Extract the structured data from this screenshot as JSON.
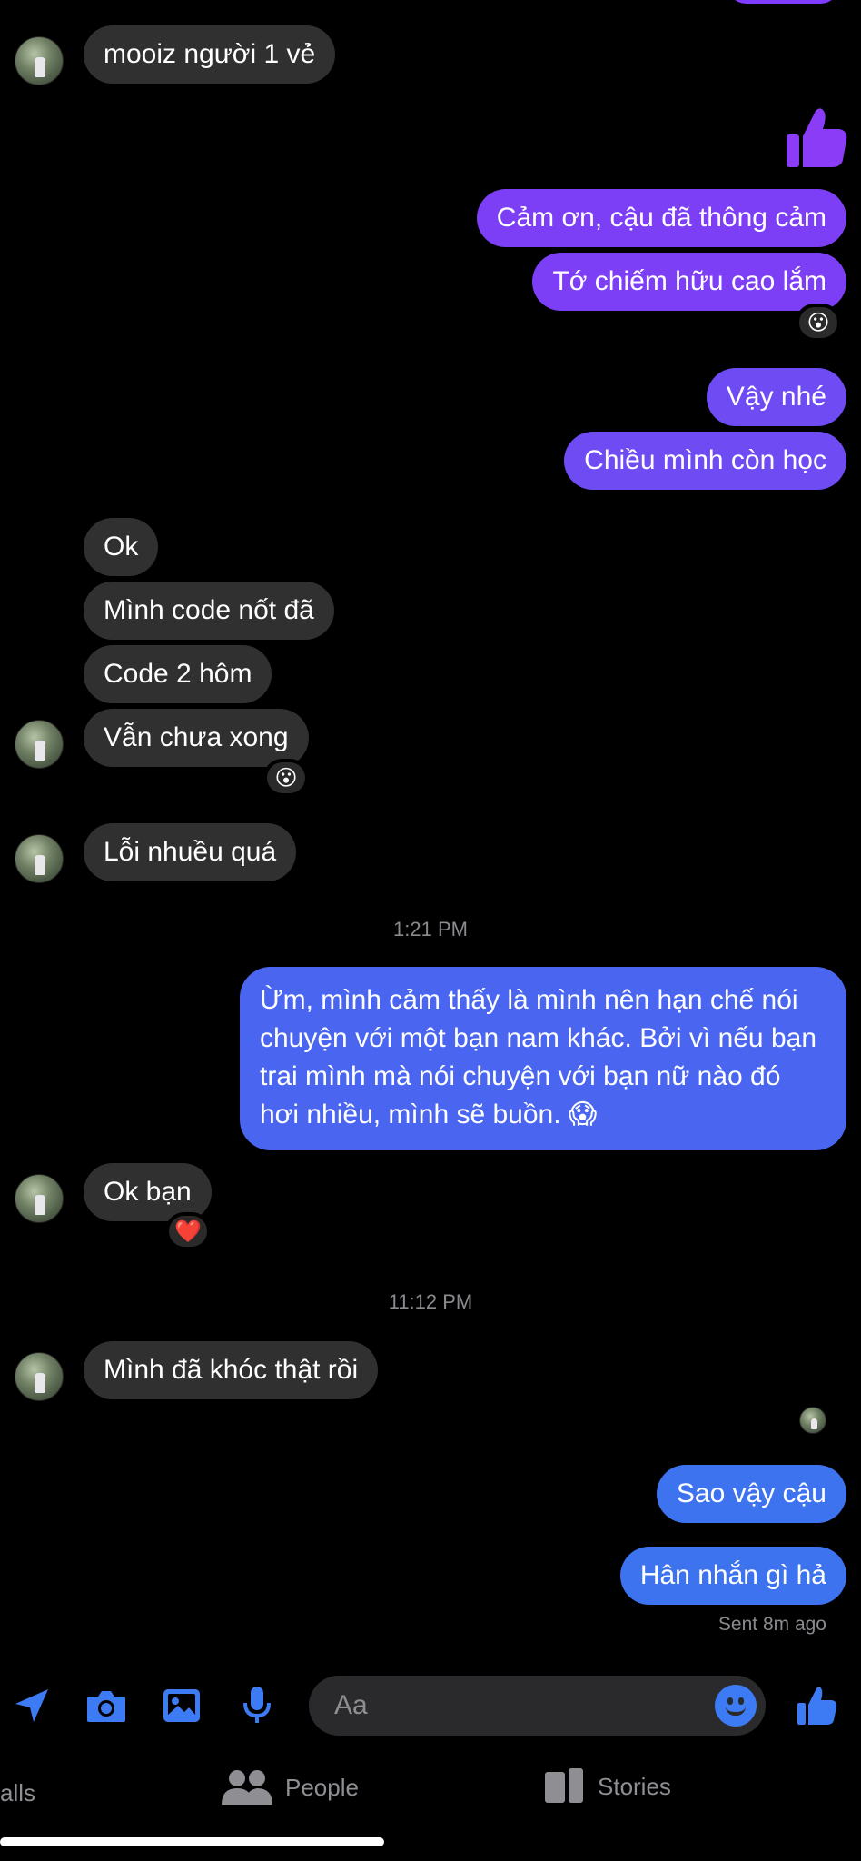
{
  "colors": {
    "incoming_bubble": "#303030",
    "outgoing_purple": "#7d3ff5",
    "outgoing_blue": "#4a66f0",
    "accent": "#3d7bf5"
  },
  "messages": {
    "m1": "mooiz người 1 vẻ",
    "m2": "Cảm ơn, cậu đã thông cảm",
    "m3": "Tớ chiếm hữu cao lắm",
    "m4": "Vậy nhé",
    "m5": "Chiều mình còn học",
    "m6": "Ok",
    "m7": "Mình code nốt đã",
    "m8": "Code 2 hôm",
    "m9": "Vẫn chưa xong",
    "m10": "Lỗi nhuều quá",
    "m11": "Ừm, mình cảm thấy là mình nên hạn chế nói chuyện với một bạn nam khác. Bởi vì nếu bạn trai mình mà nói chuyện với bạn nữ nào đó hơi nhiều, mình sẽ buồn. 😱",
    "m12": "Ok bạn",
    "m13": "Mình đã khóc thật rồi",
    "m14": "Sao vậy cậu",
    "m15": "Hân nhắn gì hả"
  },
  "reactions": {
    "r1": "😮",
    "r2": "😮",
    "r3": "❤️"
  },
  "timestamps": {
    "t1": "1:21 PM",
    "t2": "11:12 PM"
  },
  "status": {
    "sent": "Sent 8m ago"
  },
  "composer": {
    "placeholder": "Aa"
  },
  "tabs": {
    "calls": "alls",
    "people": "People",
    "stories": "Stories"
  }
}
